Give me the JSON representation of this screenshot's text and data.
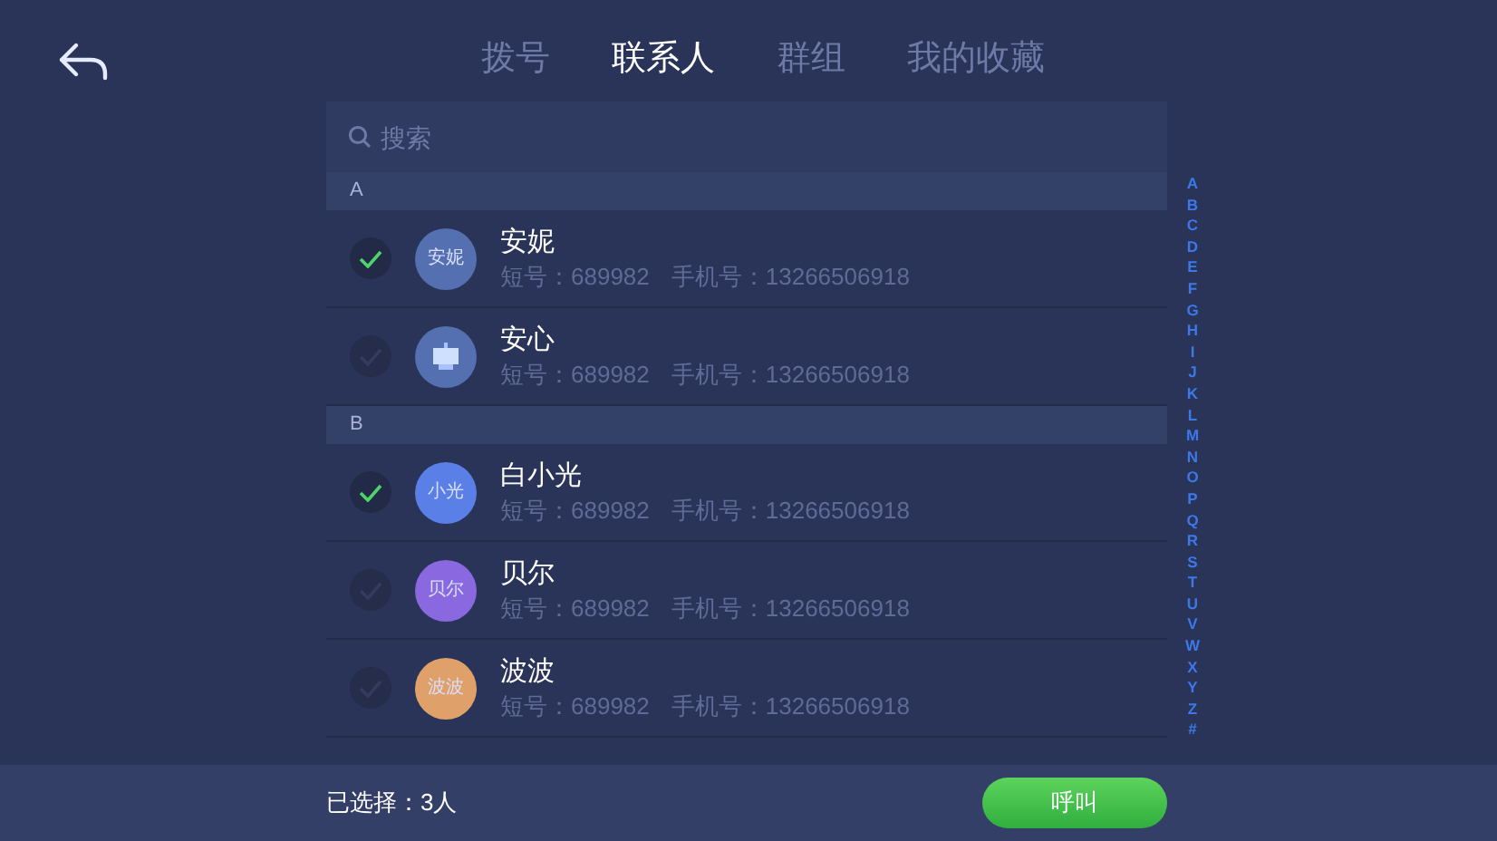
{
  "tabs": [
    {
      "label": "拨号",
      "selected": false
    },
    {
      "label": "联系人",
      "selected": true
    },
    {
      "label": "群组",
      "selected": false
    },
    {
      "label": "我的收藏",
      "selected": false
    }
  ],
  "search": {
    "placeholder": "搜索"
  },
  "sections": [
    {
      "letter": "A",
      "contacts": [
        {
          "name": "安妮",
          "avatar": {
            "kind": "text",
            "text": "安妮",
            "color": "#5470b0"
          },
          "short_label": "短号：689982",
          "mobile_label": "手机号：13266506918",
          "checked": true
        },
        {
          "name": "安心",
          "avatar": {
            "kind": "icon",
            "color": "#5470b0"
          },
          "short_label": "短号：689982",
          "mobile_label": "手机号：13266506918",
          "checked": false
        }
      ]
    },
    {
      "letter": "B",
      "contacts": [
        {
          "name": "白小光",
          "avatar": {
            "kind": "text",
            "text": "小光",
            "color": "#5a7fe6"
          },
          "short_label": "短号：689982",
          "mobile_label": "手机号：13266506918",
          "checked": true
        },
        {
          "name": "贝尔",
          "avatar": {
            "kind": "text",
            "text": "贝尔",
            "color": "#8a68e0"
          },
          "short_label": "短号：689982",
          "mobile_label": "手机号：13266506918",
          "checked": false
        },
        {
          "name": "波波",
          "avatar": {
            "kind": "text",
            "text": "波波",
            "color": "#e0a06a"
          },
          "short_label": "短号：689982",
          "mobile_label": "手机号：13266506918",
          "checked": false
        }
      ]
    }
  ],
  "index_letters": [
    "A",
    "B",
    "C",
    "D",
    "E",
    "F",
    "G",
    "H",
    "I",
    "J",
    "K",
    "L",
    "M",
    "N",
    "O",
    "P",
    "Q",
    "R",
    "S",
    "T",
    "U",
    "V",
    "W",
    "X",
    "Y",
    "Z",
    "#"
  ],
  "footer": {
    "selected_count": "已选择：3人",
    "call_button": "呼叫"
  }
}
